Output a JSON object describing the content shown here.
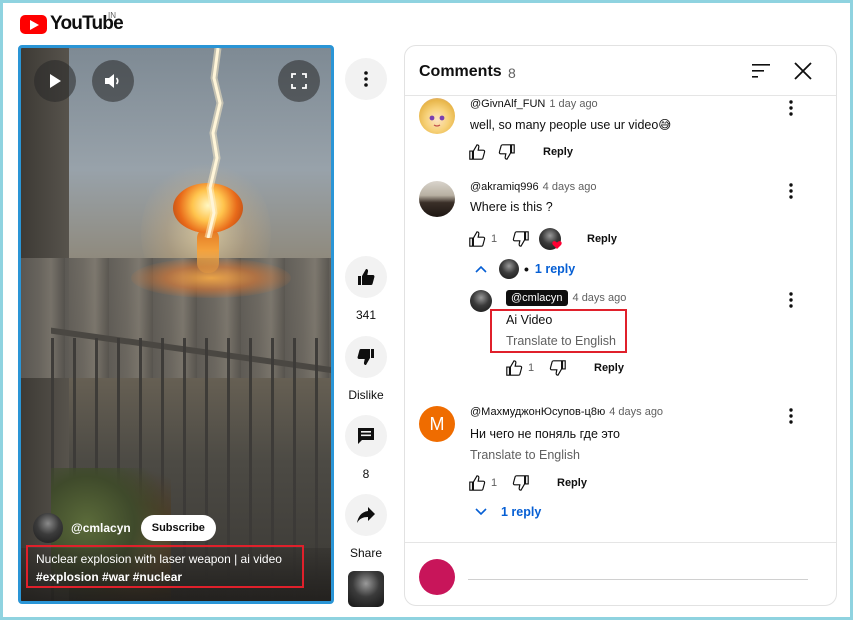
{
  "header": {
    "logo_text": "YouTube",
    "country_code": "IN"
  },
  "video": {
    "channel_name": "@cmlacyn",
    "subscribe_label": "Subscribe",
    "title": "Nuclear explosion with laser weapon | ai video",
    "hashtags": "#explosion #war #nuclear"
  },
  "actions": {
    "like_count": "341",
    "dislike_label": "Dislike",
    "comment_count": "8",
    "share_label": "Share"
  },
  "comments_panel": {
    "title": "Comments",
    "count": "8",
    "comments": [
      {
        "author": "@GivnAlf_FUN",
        "time": "1 day ago",
        "text": "well, so many people use ur video😅",
        "reply_label": "Reply"
      },
      {
        "author": "@akramiq996",
        "time": "4 days ago",
        "text": "Where is this ?",
        "likes": "1",
        "reply_label": "Reply",
        "replies_toggle": "1 reply",
        "replies": [
          {
            "author": "@cmlacyn",
            "time": "4 days ago",
            "text": "Ai Video",
            "translate": "Translate to English",
            "likes": "1",
            "reply_label": "Reply"
          }
        ]
      },
      {
        "author": "@МахмуджонЮсупов-ц8ю",
        "avatar_letter": "M",
        "time": "4 days ago",
        "text": "Ни чего не поняль где это",
        "translate": "Translate to English",
        "likes": "1",
        "reply_label": "Reply",
        "replies_toggle": "1 reply"
      }
    ]
  },
  "colors": {
    "youtube_red": "#ff0000",
    "link_blue": "#065fd4",
    "highlight_red": "#e0202b",
    "video_border": "#2a95d6",
    "m_avatar": "#ef6c00",
    "user_avatar": "#c8155a"
  }
}
